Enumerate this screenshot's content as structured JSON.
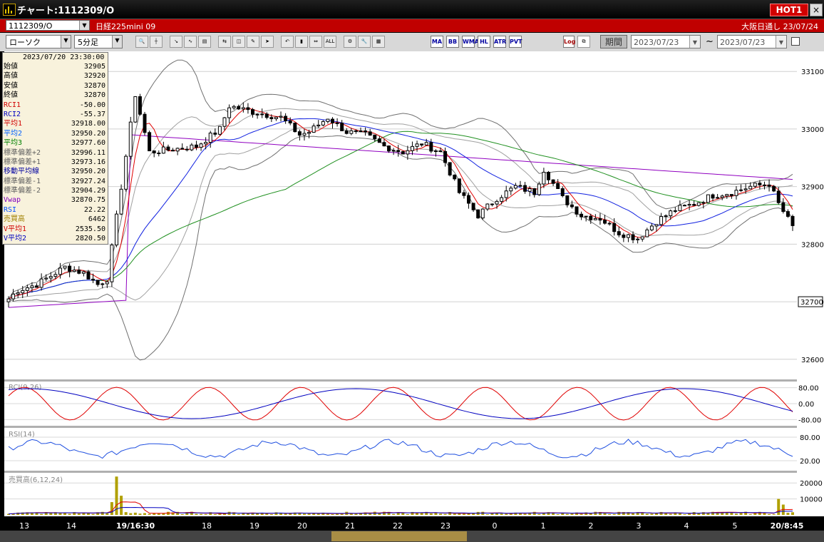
{
  "window": {
    "title": "チャート:1112309/O",
    "hot_label": "HOT1",
    "close_glyph": "×"
  },
  "infobar": {
    "symbol_code": "1112309/O",
    "instrument": "日経225mini 09",
    "session": "大阪日通し  23/07/24"
  },
  "toolbar": {
    "chart_type": "ローソク",
    "timeframe": "5分足",
    "buttons": [
      "zoom-icon",
      "crosshair-icon",
      "draw-line-icon",
      "indicator-icon",
      "chart-settings-icon",
      "compare-icon",
      "eraser-icon",
      "pencil-icon",
      "pointer-icon",
      "undo-icon",
      "volume-icon",
      "shift-icon",
      "all-icon",
      "gear-icon",
      "wrench-icon",
      "color-icon"
    ],
    "indicator_buttons": [
      "MA",
      "BB",
      "WMA",
      "HL",
      "ATR",
      "PVT"
    ],
    "log_label": "Log",
    "period_label": "期間",
    "date_from": "2023/07/23",
    "date_to": "2023/07/23",
    "tilde": "~"
  },
  "info_panel": {
    "datetime": "2023/07/20 23:30:00",
    "rows": [
      {
        "label": "始値",
        "value": "32905",
        "color": "#000000"
      },
      {
        "label": "高値",
        "value": "32920",
        "color": "#000000"
      },
      {
        "label": "安値",
        "value": "32870",
        "color": "#000000"
      },
      {
        "label": "終値",
        "value": "32870",
        "color": "#000000"
      },
      {
        "label": "RCI1",
        "value": "-50.00",
        "color": "#d00000"
      },
      {
        "label": "RCI2",
        "value": "-55.37",
        "color": "#0000c0"
      },
      {
        "label": "平均1",
        "value": "32918.00",
        "color": "#d00000"
      },
      {
        "label": "平均2",
        "value": "32950.20",
        "color": "#0060ff"
      },
      {
        "label": "平均3",
        "value": "32977.60",
        "color": "#008000"
      },
      {
        "label": "標準偏差+2",
        "value": "32996.11",
        "color": "#606060"
      },
      {
        "label": "標準偏差+1",
        "value": "32973.16",
        "color": "#606060"
      },
      {
        "label": "移動平均線",
        "value": "32950.20",
        "color": "#0000a0"
      },
      {
        "label": "標準偏差-1",
        "value": "32927.24",
        "color": "#606060"
      },
      {
        "label": "標準偏差-2",
        "value": "32904.29",
        "color": "#606060"
      },
      {
        "label": "Vwap",
        "value": "32870.75",
        "color": "#8000c0"
      },
      {
        "label": "RSI",
        "value": "22.22",
        "color": "#0050ff"
      },
      {
        "label": "売買高",
        "value": "6462",
        "color": "#a08000"
      },
      {
        "label": "V平均1",
        "value": "2535.50",
        "color": "#d00000"
      },
      {
        "label": "V平均2",
        "value": "2820.50",
        "color": "#0000c0"
      }
    ]
  },
  "chart_data": [
    {
      "type": "candlestick",
      "ylim": [
        32570,
        33130
      ],
      "yticks": [
        32600,
        32700,
        32800,
        32900,
        33000,
        33100
      ],
      "y_tag": "32700",
      "xlabels": [
        "13",
        "14",
        "19/16:30",
        "18",
        "19",
        "20",
        "21",
        "22",
        "23",
        "0",
        "1",
        "2",
        "3",
        "4",
        "5",
        "20/8:45"
      ],
      "waypoints": [
        [
          0,
          32705
        ],
        [
          2,
          32720
        ],
        [
          6,
          32730
        ],
        [
          12,
          32760
        ],
        [
          16,
          32750
        ],
        [
          19,
          32730
        ],
        [
          21,
          32740
        ],
        [
          24,
          32900
        ],
        [
          27,
          33060
        ],
        [
          30,
          32960
        ],
        [
          40,
          32970
        ],
        [
          45,
          33000
        ],
        [
          47,
          33040
        ],
        [
          52,
          33030
        ],
        [
          58,
          33020
        ],
        [
          62,
          32990
        ],
        [
          64,
          32995
        ],
        [
          68,
          33020
        ],
        [
          72,
          32995
        ],
        [
          76,
          32990
        ],
        [
          80,
          32970
        ],
        [
          84,
          32960
        ],
        [
          88,
          32975
        ],
        [
          92,
          32960
        ],
        [
          96,
          32890
        ],
        [
          100,
          32850
        ],
        [
          104,
          32880
        ],
        [
          108,
          32900
        ],
        [
          112,
          32890
        ],
        [
          114,
          32930
        ],
        [
          118,
          32880
        ],
        [
          122,
          32850
        ],
        [
          126,
          32845
        ],
        [
          130,
          32820
        ],
        [
          134,
          32810
        ],
        [
          138,
          32840
        ],
        [
          142,
          32860
        ],
        [
          146,
          32870
        ],
        [
          150,
          32885
        ],
        [
          154,
          32890
        ],
        [
          158,
          32900
        ],
        [
          162,
          32905
        ],
        [
          164,
          32870
        ],
        [
          167,
          32830
        ]
      ],
      "series": [
        {
          "name": "平均1",
          "color": "#e00000"
        },
        {
          "name": "平均2",
          "color": "#1020e0"
        },
        {
          "name": "平均3",
          "color": "#209020"
        },
        {
          "name": "標準偏差",
          "color": "#707070"
        },
        {
          "name": "Vwap",
          "color": "#9000c0"
        }
      ]
    },
    {
      "type": "line",
      "title": "RCI(9,26)",
      "yticks": [
        "80.00",
        "0.00",
        "-80.00"
      ],
      "ylim": [
        -100,
        100
      ],
      "series": [
        {
          "name": "RCI1",
          "color": "#e00000"
        },
        {
          "name": "RCI2",
          "color": "#0000c0"
        }
      ]
    },
    {
      "type": "line",
      "title": "RSI(14)",
      "yticks": [
        "80.00",
        "20.00"
      ],
      "ylim": [
        0,
        100
      ],
      "series": [
        {
          "name": "RSI",
          "color": "#2050e0"
        }
      ]
    },
    {
      "type": "bar",
      "title": "売買高(6,12,24)",
      "yticks": [
        "20000",
        "10000"
      ],
      "ylim": [
        0,
        25000
      ],
      "spikes": [
        [
          23,
          24000
        ],
        [
          24,
          12000
        ],
        [
          22,
          8000
        ],
        [
          164,
          10000
        ],
        [
          165,
          6462
        ]
      ]
    }
  ]
}
